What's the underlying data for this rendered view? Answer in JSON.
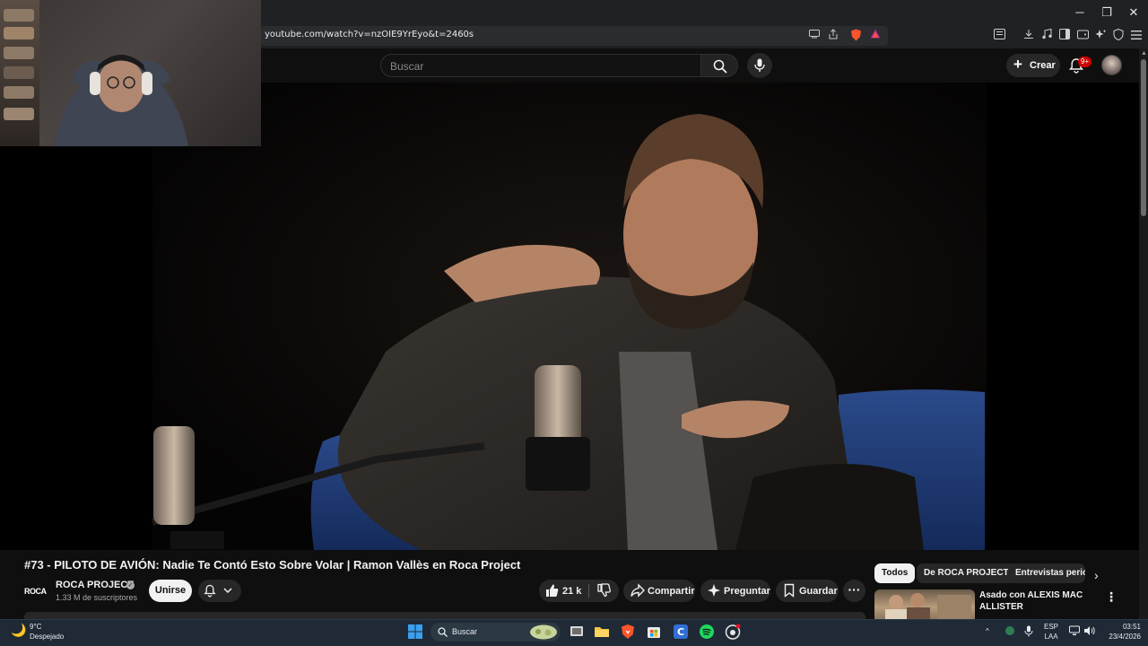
{
  "browser": {
    "url": "youtube.com/watch?v=nzOIE9YrEyo&t=2460s",
    "window_controls": {
      "minimize": "─",
      "restore": "❐",
      "close": "✕"
    }
  },
  "youtube": {
    "search_placeholder": "Buscar",
    "create_label": "Crear",
    "notification_badge": "9+"
  },
  "video": {
    "title": "#73 - PILOTO DE AVIÓN: Nadie Te Contó Esto Sobre Volar | Ramon Vallès en Roca Project",
    "channel_logo": "ROCA",
    "channel_name": "ROCA PROJECT",
    "subscribers": "1.33 M de suscriptores",
    "join_label": "Unirse",
    "likes": "21 k",
    "share_label": "Compartir",
    "ask_label": "Preguntar",
    "save_label": "Guardar",
    "more_label": "···"
  },
  "sidebar": {
    "chips": [
      "Todos",
      "De ROCA PROJECT",
      "Entrevistas period"
    ],
    "next_label": "›",
    "recommendation": {
      "title": "Asado con ALEXIS MAC ALLISTER",
      "more": "⋮"
    }
  },
  "taskbar": {
    "weather_temp": "9°C",
    "weather_condition": "Despejado",
    "search_label": "Buscar",
    "lang_top": "ESP",
    "lang_bottom": "LAA",
    "time": "03:51",
    "date": "23/4/2026"
  }
}
